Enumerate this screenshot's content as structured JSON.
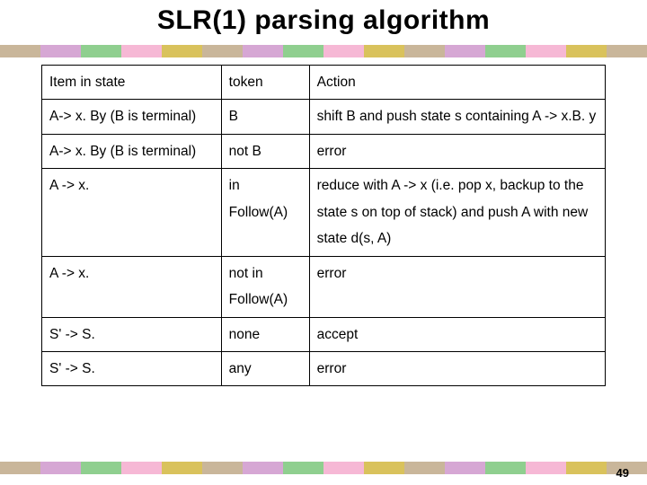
{
  "title": "SLR(1) parsing algorithm",
  "page_number": "49",
  "headers": {
    "item": "Item in state",
    "token": "token",
    "action": "Action"
  },
  "rows": [
    {
      "item": "A-> x. By (B is terminal)",
      "token": "B",
      "action": "shift B and push state s containing A -> x.B. y"
    },
    {
      "item": "A-> x. By (B is terminal)",
      "token": "not B",
      "action": "error"
    },
    {
      "item": "A -> x.",
      "token": "in Follow(A)",
      "action": "reduce with A -> x (i.e. pop x, backup to the state s on top of stack) and push A with new state d(s, A)"
    },
    {
      "item": "A -> x.",
      "token": "not in Follow(A)",
      "action": "error"
    },
    {
      "item": "S' -> S.",
      "token": "none",
      "action": "accept"
    },
    {
      "item": "S' -> S.",
      "token": "any",
      "action": "error"
    }
  ],
  "chart_data": {
    "type": "table",
    "title": "SLR(1) parsing algorithm",
    "columns": [
      "Item in state",
      "token",
      "Action"
    ],
    "data": [
      [
        "A-> x. By (B is terminal)",
        "B",
        "shift B and push state s containing A -> x.B. y"
      ],
      [
        "A-> x. By (B is terminal)",
        "not B",
        "error"
      ],
      [
        "A -> x.",
        "in Follow(A)",
        "reduce with A -> x (i.e. pop x, backup to the state s on top of stack) and push A with new state d(s, A)"
      ],
      [
        "A -> x.",
        "not in Follow(A)",
        "error"
      ],
      [
        "S' -> S.",
        "none",
        "accept"
      ],
      [
        "S' -> S.",
        "any",
        "error"
      ]
    ]
  }
}
